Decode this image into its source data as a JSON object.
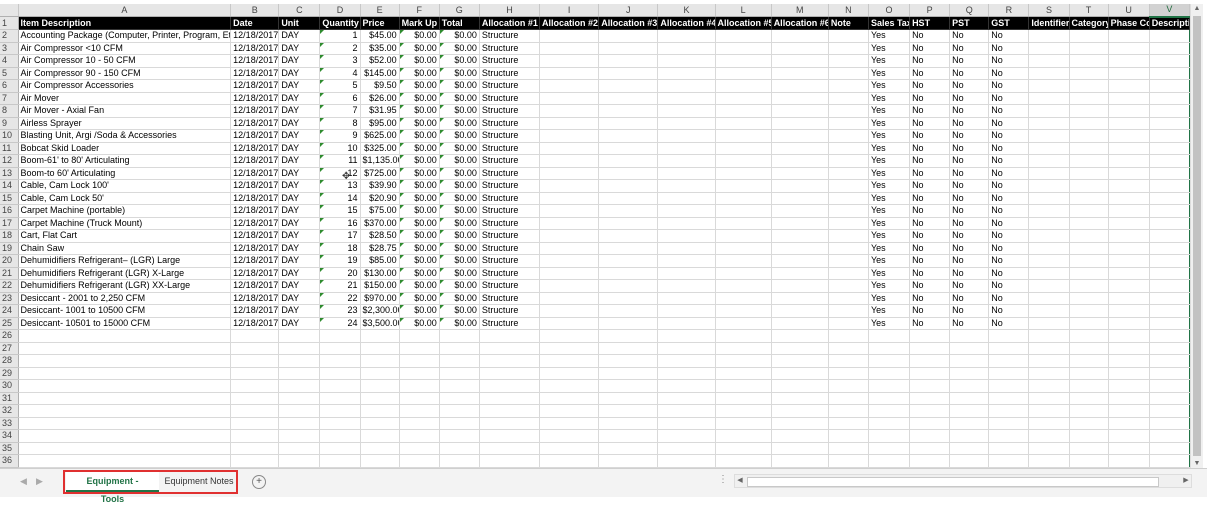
{
  "columns": [
    "A",
    "B",
    "C",
    "D",
    "E",
    "F",
    "G",
    "H",
    "I",
    "J",
    "K",
    "L",
    "M",
    "N",
    "O",
    "P",
    "Q",
    "R",
    "S",
    "T",
    "U",
    "V"
  ],
  "selected_column": "V",
  "header_row": [
    "Item Description",
    "Date",
    "Unit",
    "Quantity",
    "Price",
    "Mark Up",
    "Total",
    "Allocation #1",
    "Allocation #2",
    "Allocation #3",
    "Allocation #4",
    "Allocation #5",
    "Allocation #6",
    "Note",
    "Sales Tax",
    "HST",
    "PST",
    "GST",
    "Identifier",
    "Category",
    "Phase Coc",
    "Descriptio"
  ],
  "rows": [
    [
      "Accounting Package (Computer, Printer, Program, Etc)",
      "12/18/2017",
      "DAY",
      "1",
      "$45.00",
      "$0.00",
      "$0.00",
      "Structure",
      "",
      "",
      "",
      "",
      "",
      "",
      "Yes",
      "No",
      "No",
      "No",
      "",
      "",
      "",
      ""
    ],
    [
      "Air Compressor <10 CFM",
      "12/18/2017",
      "DAY",
      "2",
      "$35.00",
      "$0.00",
      "$0.00",
      "Structure",
      "",
      "",
      "",
      "",
      "",
      "",
      "Yes",
      "No",
      "No",
      "No",
      "",
      "",
      "",
      ""
    ],
    [
      "Air Compressor 10 - 50 CFM",
      "12/18/2017",
      "DAY",
      "3",
      "$52.00",
      "$0.00",
      "$0.00",
      "Structure",
      "",
      "",
      "",
      "",
      "",
      "",
      "Yes",
      "No",
      "No",
      "No",
      "",
      "",
      "",
      ""
    ],
    [
      "Air Compressor 90 - 150 CFM",
      "12/18/2017",
      "DAY",
      "4",
      "$145.00",
      "$0.00",
      "$0.00",
      "Structure",
      "",
      "",
      "",
      "",
      "",
      "",
      "Yes",
      "No",
      "No",
      "No",
      "",
      "",
      "",
      ""
    ],
    [
      "Air Compressor Accessories",
      "12/18/2017",
      "DAY",
      "5",
      "$9.50",
      "$0.00",
      "$0.00",
      "Structure",
      "",
      "",
      "",
      "",
      "",
      "",
      "Yes",
      "No",
      "No",
      "No",
      "",
      "",
      "",
      ""
    ],
    [
      "Air Mover",
      "12/18/2017",
      "DAY",
      "6",
      "$26.00",
      "$0.00",
      "$0.00",
      "Structure",
      "",
      "",
      "",
      "",
      "",
      "",
      "Yes",
      "No",
      "No",
      "No",
      "",
      "",
      "",
      ""
    ],
    [
      "Air Mover - Axial Fan",
      "12/18/2017",
      "DAY",
      "7",
      "$31.95",
      "$0.00",
      "$0.00",
      "Structure",
      "",
      "",
      "",
      "",
      "",
      "",
      "Yes",
      "No",
      "No",
      "No",
      "",
      "",
      "",
      ""
    ],
    [
      "Airless Sprayer",
      "12/18/2017",
      "DAY",
      "8",
      "$95.00",
      "$0.00",
      "$0.00",
      "Structure",
      "",
      "",
      "",
      "",
      "",
      "",
      "Yes",
      "No",
      "No",
      "No",
      "",
      "",
      "",
      ""
    ],
    [
      "Blasting Unit, Argi /Soda & Accessories",
      "12/18/2017",
      "DAY",
      "9",
      "$625.00",
      "$0.00",
      "$0.00",
      "Structure",
      "",
      "",
      "",
      "",
      "",
      "",
      "Yes",
      "No",
      "No",
      "No",
      "",
      "",
      "",
      ""
    ],
    [
      "Bobcat Skid Loader",
      "12/18/2017",
      "DAY",
      "10",
      "$325.00",
      "$0.00",
      "$0.00",
      "Structure",
      "",
      "",
      "",
      "",
      "",
      "",
      "Yes",
      "No",
      "No",
      "No",
      "",
      "",
      "",
      ""
    ],
    [
      "Boom-61' to 80' Articulating",
      "12/18/2017",
      "DAY",
      "11",
      "$1,135.00",
      "$0.00",
      "$0.00",
      "Structure",
      "",
      "",
      "",
      "",
      "",
      "",
      "Yes",
      "No",
      "No",
      "No",
      "",
      "",
      "",
      ""
    ],
    [
      "Boom-to 60' Articulating",
      "12/18/2017",
      "DAY",
      "12",
      "$725.00",
      "$0.00",
      "$0.00",
      "Structure",
      "",
      "",
      "",
      "",
      "",
      "",
      "Yes",
      "No",
      "No",
      "No",
      "",
      "",
      "",
      ""
    ],
    [
      "Cable, Cam Lock 100'",
      "12/18/2017",
      "DAY",
      "13",
      "$39.90",
      "$0.00",
      "$0.00",
      "Structure",
      "",
      "",
      "",
      "",
      "",
      "",
      "Yes",
      "No",
      "No",
      "No",
      "",
      "",
      "",
      ""
    ],
    [
      "Cable, Cam Lock 50'",
      "12/18/2017",
      "DAY",
      "14",
      "$20.90",
      "$0.00",
      "$0.00",
      "Structure",
      "",
      "",
      "",
      "",
      "",
      "",
      "Yes",
      "No",
      "No",
      "No",
      "",
      "",
      "",
      ""
    ],
    [
      "Carpet Machine (portable)",
      "12/18/2017",
      "DAY",
      "15",
      "$75.00",
      "$0.00",
      "$0.00",
      "Structure",
      "",
      "",
      "",
      "",
      "",
      "",
      "Yes",
      "No",
      "No",
      "No",
      "",
      "",
      "",
      ""
    ],
    [
      "Carpet Machine (Truck Mount)",
      "12/18/2017",
      "DAY",
      "16",
      "$370.00",
      "$0.00",
      "$0.00",
      "Structure",
      "",
      "",
      "",
      "",
      "",
      "",
      "Yes",
      "No",
      "No",
      "No",
      "",
      "",
      "",
      ""
    ],
    [
      "Cart, Flat Cart",
      "12/18/2017",
      "DAY",
      "17",
      "$28.50",
      "$0.00",
      "$0.00",
      "Structure",
      "",
      "",
      "",
      "",
      "",
      "",
      "Yes",
      "No",
      "No",
      "No",
      "",
      "",
      "",
      ""
    ],
    [
      "Chain Saw",
      "12/18/2017",
      "DAY",
      "18",
      "$28.75",
      "$0.00",
      "$0.00",
      "Structure",
      "",
      "",
      "",
      "",
      "",
      "",
      "Yes",
      "No",
      "No",
      "No",
      "",
      "",
      "",
      ""
    ],
    [
      "Dehumidifiers Refrigerant– (LGR) Large",
      "12/18/2017",
      "DAY",
      "19",
      "$85.00",
      "$0.00",
      "$0.00",
      "Structure",
      "",
      "",
      "",
      "",
      "",
      "",
      "Yes",
      "No",
      "No",
      "No",
      "",
      "",
      "",
      ""
    ],
    [
      "Dehumidifiers Refrigerant (LGR) X-Large",
      "12/18/2017",
      "DAY",
      "20",
      "$130.00",
      "$0.00",
      "$0.00",
      "Structure",
      "",
      "",
      "",
      "",
      "",
      "",
      "Yes",
      "No",
      "No",
      "No",
      "",
      "",
      "",
      ""
    ],
    [
      "Dehumidifiers Refrigerant (LGR) XX-Large",
      "12/18/2017",
      "DAY",
      "21",
      "$150.00",
      "$0.00",
      "$0.00",
      "Structure",
      "",
      "",
      "",
      "",
      "",
      "",
      "Yes",
      "No",
      "No",
      "No",
      "",
      "",
      "",
      ""
    ],
    [
      "Desiccant - 2001 to 2,250 CFM",
      "12/18/2017",
      "DAY",
      "22",
      "$970.00",
      "$0.00",
      "$0.00",
      "Structure",
      "",
      "",
      "",
      "",
      "",
      "",
      "Yes",
      "No",
      "No",
      "No",
      "",
      "",
      "",
      ""
    ],
    [
      "Desiccant- 1001 to 10500 CFM",
      "12/18/2017",
      "DAY",
      "23",
      "$2,300.00",
      "$0.00",
      "$0.00",
      "Structure",
      "",
      "",
      "",
      "",
      "",
      "",
      "Yes",
      "No",
      "No",
      "No",
      "",
      "",
      "",
      ""
    ],
    [
      "Desiccant- 10501 to 15000 CFM",
      "12/18/2017",
      "DAY",
      "24",
      "$3,500.00",
      "$0.00",
      "$0.00",
      "Structure",
      "",
      "",
      "",
      "",
      "",
      "",
      "Yes",
      "No",
      "No",
      "No",
      "",
      "",
      "",
      ""
    ]
  ],
  "empty_row_numbers": [
    "26",
    "27",
    "28",
    "29",
    "30",
    "31",
    "32",
    "33",
    "34",
    "35",
    "36"
  ],
  "sheet_tabs": [
    {
      "label": "Equipment - Tools",
      "active": true
    },
    {
      "label": "Equipment Notes",
      "active": false
    }
  ],
  "add_sheet_label": "+",
  "icons": {
    "add_sheet": "plus-circle-icon",
    "prev_sheet": "chevron-left-icon",
    "next_sheet": "chevron-right-icon",
    "cursor": "move-cursor-icon"
  },
  "colors": {
    "accent": "#217346",
    "tab_highlight": "#e03030",
    "header_fill": "#000000"
  }
}
